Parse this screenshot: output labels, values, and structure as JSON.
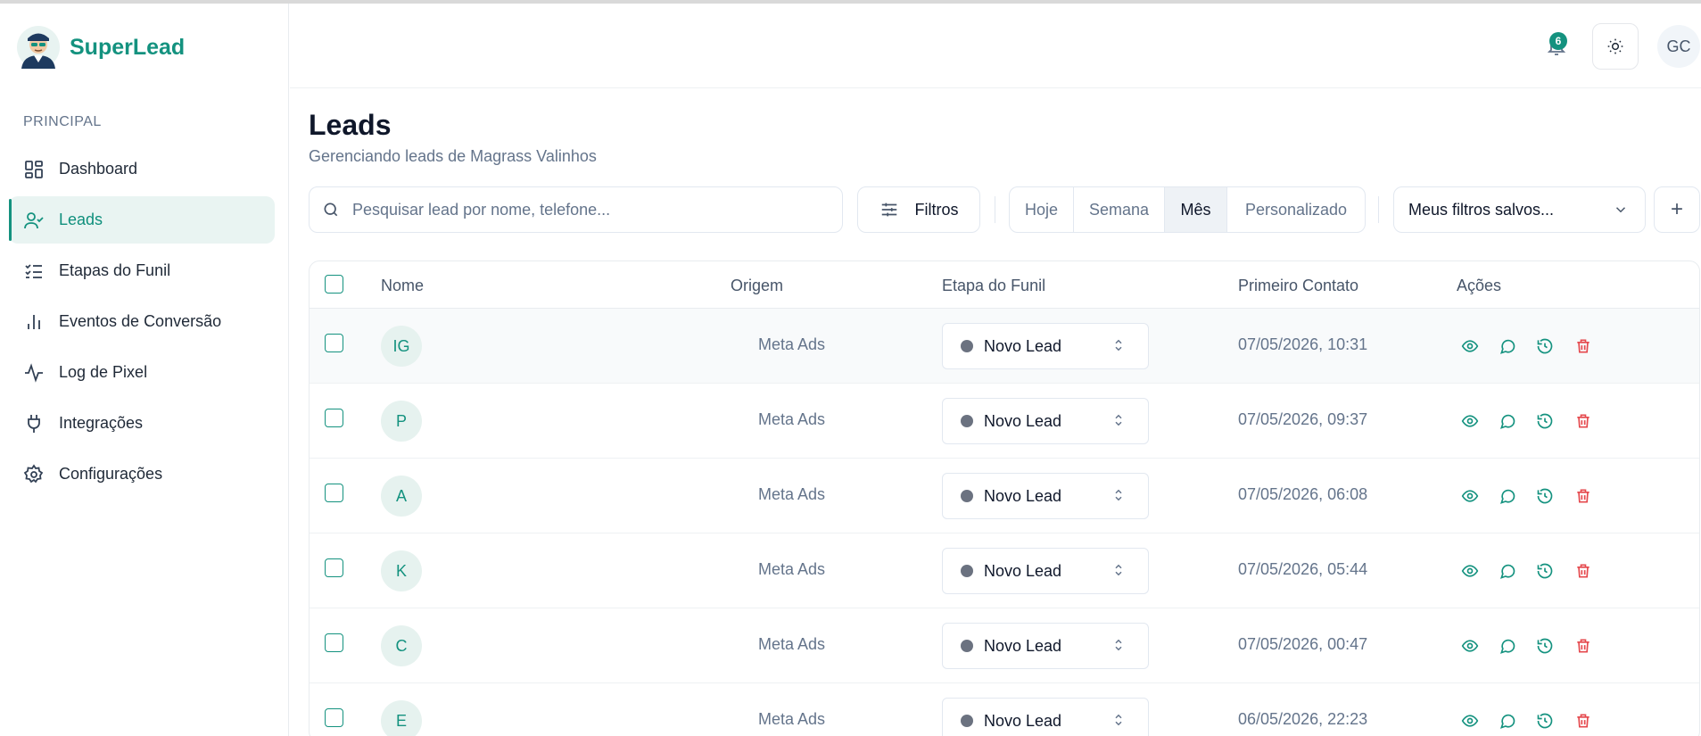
{
  "app": {
    "name": "SuperLead"
  },
  "sidebar": {
    "section_label": "PRINCIPAL",
    "items": [
      {
        "label": "Dashboard",
        "icon": "dashboard-icon",
        "active": false
      },
      {
        "label": "Leads",
        "icon": "user-check-icon",
        "active": true
      },
      {
        "label": "Etapas do Funil",
        "icon": "list-check-icon",
        "active": false
      },
      {
        "label": "Eventos de Conversão",
        "icon": "bar-chart-icon",
        "active": false
      },
      {
        "label": "Log de Pixel",
        "icon": "activity-icon",
        "active": false
      },
      {
        "label": "Integrações",
        "icon": "plug-icon",
        "active": false
      },
      {
        "label": "Configurações",
        "icon": "gear-icon",
        "active": false
      }
    ]
  },
  "header": {
    "notification_count": "6",
    "user_initials": "GC"
  },
  "page": {
    "title": "Leads",
    "subtitle": "Gerenciando leads de Magrass Valinhos"
  },
  "toolbar": {
    "search_placeholder": "Pesquisar lead por nome, telefone...",
    "filter_label": "Filtros",
    "periods": [
      "Hoje",
      "Semana",
      "Mês",
      "Personalizado"
    ],
    "active_period": "Mês",
    "saved_filters_label": "Meus filtros salvos...",
    "add_label": "+"
  },
  "table": {
    "columns": [
      "Nome",
      "Origem",
      "Etapa do Funil",
      "Primeiro Contato",
      "Ações"
    ],
    "rows": [
      {
        "initials": "IG",
        "origin": "Meta Ads",
        "stage": "Novo Lead",
        "first_contact": "07/05/2026, 10:31"
      },
      {
        "initials": "P",
        "origin": "Meta Ads",
        "stage": "Novo Lead",
        "first_contact": "07/05/2026, 09:37"
      },
      {
        "initials": "A",
        "origin": "Meta Ads",
        "stage": "Novo Lead",
        "first_contact": "07/05/2026, 06:08"
      },
      {
        "initials": "K",
        "origin": "Meta Ads",
        "stage": "Novo Lead",
        "first_contact": "07/05/2026, 05:44"
      },
      {
        "initials": "C",
        "origin": "Meta Ads",
        "stage": "Novo Lead",
        "first_contact": "07/05/2026, 00:47"
      },
      {
        "initials": "E",
        "origin": "Meta Ads",
        "stage": "Novo Lead",
        "first_contact": "06/05/2026, 22:23"
      }
    ]
  },
  "colors": {
    "accent": "#14927f",
    "danger": "#e5484d",
    "stage_dot": "#6b7280"
  }
}
